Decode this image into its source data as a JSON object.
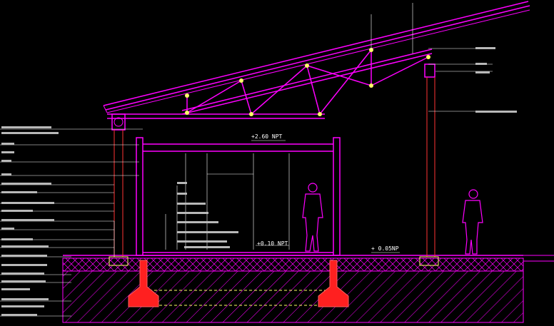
{
  "drawing": {
    "level_labels": {
      "ceiling": "+2.60 NPT",
      "floor": "+0.10 NPT",
      "exterior": "+ 0.05NP"
    },
    "colors": {
      "background": "#000000",
      "structure": "#ff00ff",
      "weld_nodes": "#ffff66",
      "leader_lines": "#ffffff",
      "columns": "#ff3333",
      "footings": "#ff2020",
      "text": "#ffffff"
    }
  }
}
